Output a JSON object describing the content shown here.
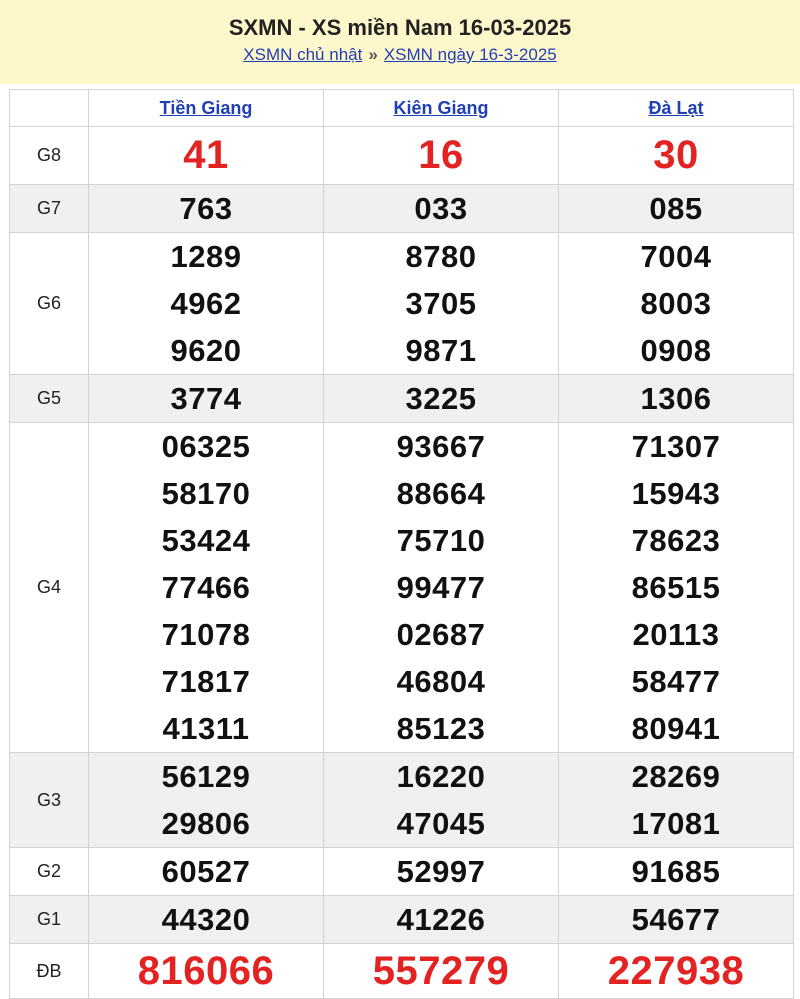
{
  "header": {
    "title": "SXMN - XS miền Nam 16-03-2025",
    "link_day": "XSMN chủ nhật",
    "separator": "»",
    "link_date": "XSMN ngày 16-3-2025"
  },
  "provinces": [
    "Tiền Giang",
    "Kiên Giang",
    "Đà Lạt"
  ],
  "rows": [
    {
      "prize": "G8",
      "results": [
        [
          "41"
        ],
        [
          "16"
        ],
        [
          "30"
        ]
      ]
    },
    {
      "prize": "G7",
      "results": [
        [
          "763"
        ],
        [
          "033"
        ],
        [
          "085"
        ]
      ]
    },
    {
      "prize": "G6",
      "results": [
        [
          "1289",
          "4962",
          "9620"
        ],
        [
          "8780",
          "3705",
          "9871"
        ],
        [
          "7004",
          "8003",
          "0908"
        ]
      ]
    },
    {
      "prize": "G5",
      "results": [
        [
          "3774"
        ],
        [
          "3225"
        ],
        [
          "1306"
        ]
      ]
    },
    {
      "prize": "G4",
      "results": [
        [
          "06325",
          "58170",
          "53424",
          "77466",
          "71078",
          "71817",
          "41311"
        ],
        [
          "93667",
          "88664",
          "75710",
          "99477",
          "02687",
          "46804",
          "85123"
        ],
        [
          "71307",
          "15943",
          "78623",
          "86515",
          "20113",
          "58477",
          "80941"
        ]
      ]
    },
    {
      "prize": "G3",
      "results": [
        [
          "56129",
          "29806"
        ],
        [
          "16220",
          "47045"
        ],
        [
          "28269",
          "17081"
        ]
      ]
    },
    {
      "prize": "G2",
      "results": [
        [
          "60527"
        ],
        [
          "52997"
        ],
        [
          "91685"
        ]
      ]
    },
    {
      "prize": "G1",
      "results": [
        [
          "44320"
        ],
        [
          "41226"
        ],
        [
          "54677"
        ]
      ]
    },
    {
      "prize": "ĐB",
      "results": [
        [
          "816066"
        ],
        [
          "557279"
        ],
        [
          "227938"
        ]
      ]
    }
  ],
  "colors": {
    "header_bg": "#fff7cc",
    "link": "#1f3fb5",
    "highlight": "#e32222",
    "row_shade": "#f0f0f0"
  }
}
